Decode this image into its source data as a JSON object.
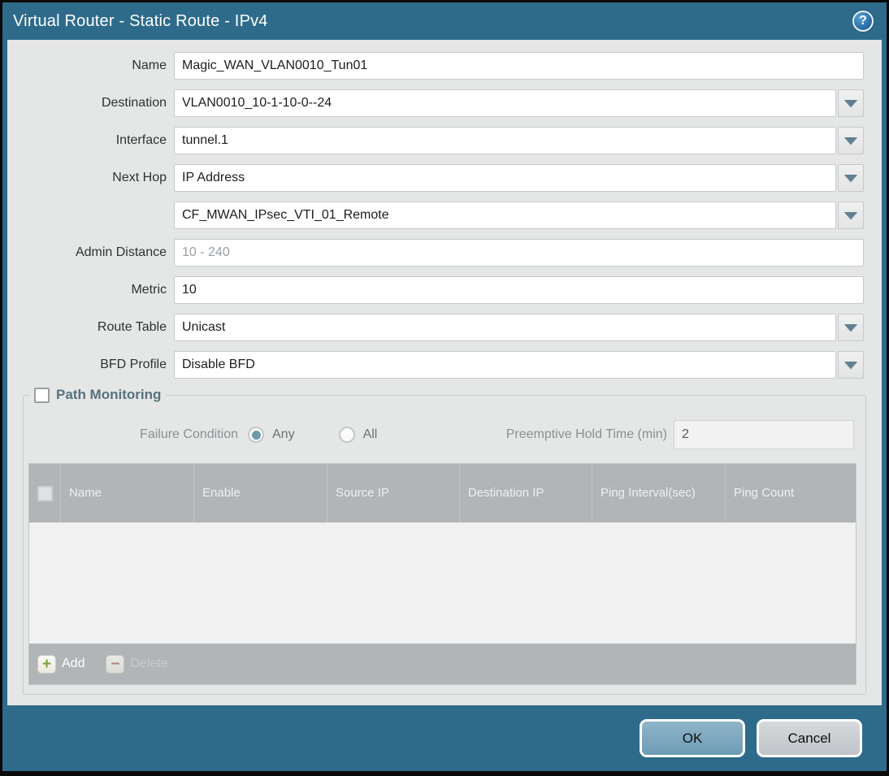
{
  "dialog": {
    "title": "Virtual Router - Static Route - IPv4"
  },
  "form": {
    "name": {
      "label": "Name",
      "value": "Magic_WAN_VLAN0010_Tun01"
    },
    "destination": {
      "label": "Destination",
      "value": "VLAN0010_10-1-10-0--24"
    },
    "interface": {
      "label": "Interface",
      "value": "tunnel.1"
    },
    "next_hop": {
      "label": "Next Hop",
      "value": "IP Address"
    },
    "next_hop_address": {
      "value": "CF_MWAN_IPsec_VTI_01_Remote"
    },
    "admin_distance": {
      "label": "Admin Distance",
      "value": "",
      "placeholder": "10 - 240"
    },
    "metric": {
      "label": "Metric",
      "value": "10"
    },
    "route_table": {
      "label": "Route Table",
      "value": "Unicast"
    },
    "bfd_profile": {
      "label": "BFD Profile",
      "value": "Disable BFD"
    }
  },
  "path_monitoring": {
    "title": "Path Monitoring",
    "checkbox_checked": false,
    "failure_condition": {
      "label": "Failure Condition",
      "options": [
        "Any",
        "All"
      ],
      "selected": "Any"
    },
    "preemptive_hold_time": {
      "label": "Preemptive Hold Time (min)",
      "value": "2"
    },
    "table": {
      "columns": [
        "Name",
        "Enable",
        "Source IP",
        "Destination IP",
        "Ping Interval(sec)",
        "Ping Count"
      ],
      "rows": []
    },
    "toolbar": {
      "add_label": "Add",
      "delete_label": "Delete"
    }
  },
  "footer": {
    "ok_label": "OK",
    "cancel_label": "Cancel"
  },
  "icons": {
    "help": "help-icon",
    "chevron_down": "chevron-down-icon",
    "add_plus": "plus-icon",
    "delete_minus": "minus-icon"
  },
  "help_glyph": "?",
  "add_glyph": "+",
  "minus_glyph": "−",
  "colors": {
    "titlebar_teal": "#2e6b8a",
    "panel_gray": "#e5e6e6",
    "table_header_gray": "#b1b5b7",
    "ok_button_blue": "#7ea7bd",
    "cancel_button_gray": "#c9ced2",
    "add_icon_green": "#7ca62f",
    "delete_icon_red": "#b5766f",
    "radio_selected_teal": "#6e97aa"
  }
}
